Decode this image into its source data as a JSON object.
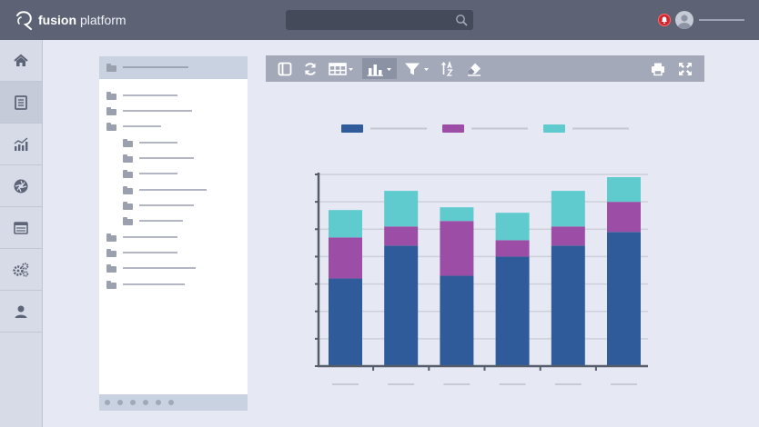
{
  "app": {
    "brand_bold": "fusion",
    "brand_light": "platform"
  },
  "topbar": {
    "search_placeholder": ""
  },
  "sidebar": {
    "items": [
      {
        "icon": "home-icon"
      },
      {
        "icon": "document-icon",
        "active": true
      },
      {
        "icon": "analytics-icon"
      },
      {
        "icon": "aperture-icon"
      },
      {
        "icon": "calendar-icon"
      },
      {
        "icon": "gears-icon"
      },
      {
        "icon": "user-icon"
      }
    ]
  },
  "tree": {
    "root": {
      "icon": "folder-icon"
    },
    "items": [
      {
        "level": 0,
        "icon": "folder-icon"
      },
      {
        "level": 0,
        "icon": "folder-icon"
      },
      {
        "level": 0,
        "icon": "folder-open-icon"
      },
      {
        "level": 1,
        "icon": "folder-icon"
      },
      {
        "level": 1,
        "icon": "folder-icon"
      },
      {
        "level": 1,
        "icon": "folder-icon"
      },
      {
        "level": 1,
        "icon": "folder-icon"
      },
      {
        "level": 1,
        "icon": "folder-icon"
      },
      {
        "level": 1,
        "icon": "folder-icon"
      },
      {
        "level": 0,
        "icon": "folder-icon"
      },
      {
        "level": 0,
        "icon": "folder-icon"
      },
      {
        "level": 0,
        "icon": "folder-icon"
      },
      {
        "level": 0,
        "icon": "folder-icon"
      }
    ],
    "pager_dots": 6
  },
  "toolbar": {
    "buttons": [
      {
        "icon": "panel-icon"
      },
      {
        "icon": "refresh-icon"
      },
      {
        "icon": "table-icon",
        "dropdown": true
      },
      {
        "icon": "bar-chart-icon",
        "dropdown": true,
        "active": true
      },
      {
        "icon": "filter-icon",
        "dropdown": true
      },
      {
        "icon": "sort-az-icon"
      },
      {
        "icon": "eraser-icon"
      },
      {
        "icon": "print-icon"
      },
      {
        "icon": "fullscreen-icon"
      }
    ]
  },
  "colors": {
    "series1": "#2f5b9a",
    "series2": "#9c4ea6",
    "series3": "#5fcbcf"
  },
  "chart_data": {
    "type": "bar",
    "stacked": true,
    "categories": [
      "",
      "",
      "",
      "",
      "",
      ""
    ],
    "series": [
      {
        "values": [
          32,
          44,
          33,
          40,
          44,
          49
        ]
      },
      {
        "values": [
          15,
          7,
          20,
          6,
          7,
          11
        ]
      },
      {
        "values": [
          10,
          13,
          5,
          10,
          13,
          9
        ]
      }
    ],
    "ylim": [
      0,
      70
    ],
    "grid": true,
    "legend": "top"
  }
}
